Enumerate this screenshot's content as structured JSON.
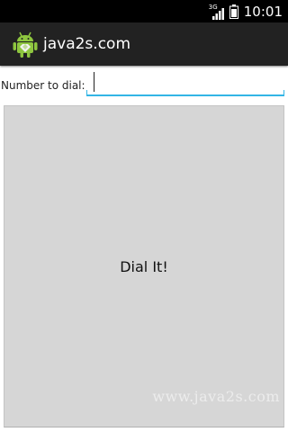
{
  "status_bar": {
    "network_type": "3G",
    "time": "10:01",
    "icons": [
      "signal-icon",
      "battery-icon"
    ]
  },
  "action_bar": {
    "title": "java2s.com",
    "icon": "android-robot-icon"
  },
  "form": {
    "label": "Number to dial:",
    "input_value": "",
    "accent_color": "#33b5e5"
  },
  "dial_button": {
    "label": "Dial It!"
  },
  "watermark": "www.java2s.com"
}
